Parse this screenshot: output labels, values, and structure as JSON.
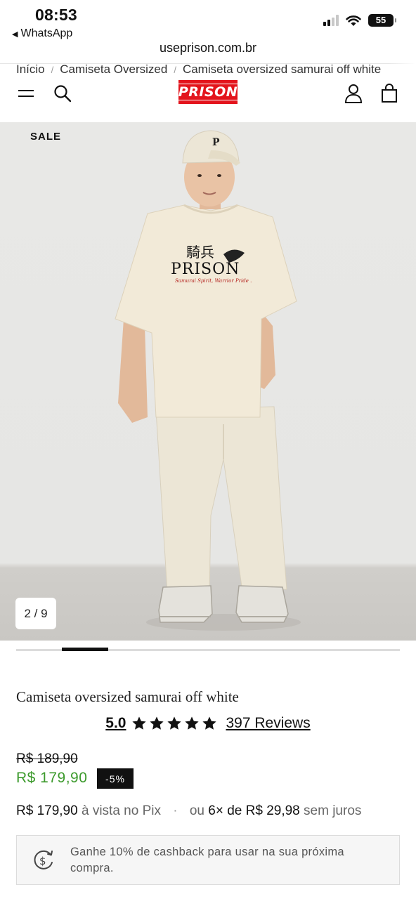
{
  "status_bar": {
    "time": "08:53",
    "back_app": "WhatsApp",
    "battery": "55"
  },
  "browser": {
    "url": "useprison.com.br"
  },
  "breadcrumb": {
    "items": [
      "Início",
      "Camiseta Oversized",
      "Camiseta oversized samurai off white"
    ],
    "separator": "/"
  },
  "header": {
    "logo_text": "PRISON",
    "brand_color": "#e3141c",
    "icons": [
      "menu-icon",
      "search-icon",
      "account-icon",
      "bag-icon"
    ]
  },
  "gallery": {
    "badge": "SALE",
    "counter": "2 / 9",
    "current_index": 2,
    "total": 9,
    "shirt_print": {
      "kanji": "騎兵",
      "brand": "PRISON",
      "tagline": "Samurai Spirit, Warrior Pride ."
    }
  },
  "product": {
    "title": "Camiseta oversized samurai off white",
    "rating": "5.0",
    "stars": 5,
    "reviews": "397 Reviews",
    "old_price": "R$ 189,90",
    "price": "R$ 179,90",
    "price_color": "#3c9a2c",
    "discount": "-5%",
    "pix_price": "R$ 179,90",
    "pix_label": "à vista no Pix",
    "installments_prefix": "ou",
    "installments": "6× de R$ 29,98",
    "installments_suffix": "sem juros",
    "cashback_text": "Ganhe 10% de cashback para usar na sua próxima compra."
  }
}
